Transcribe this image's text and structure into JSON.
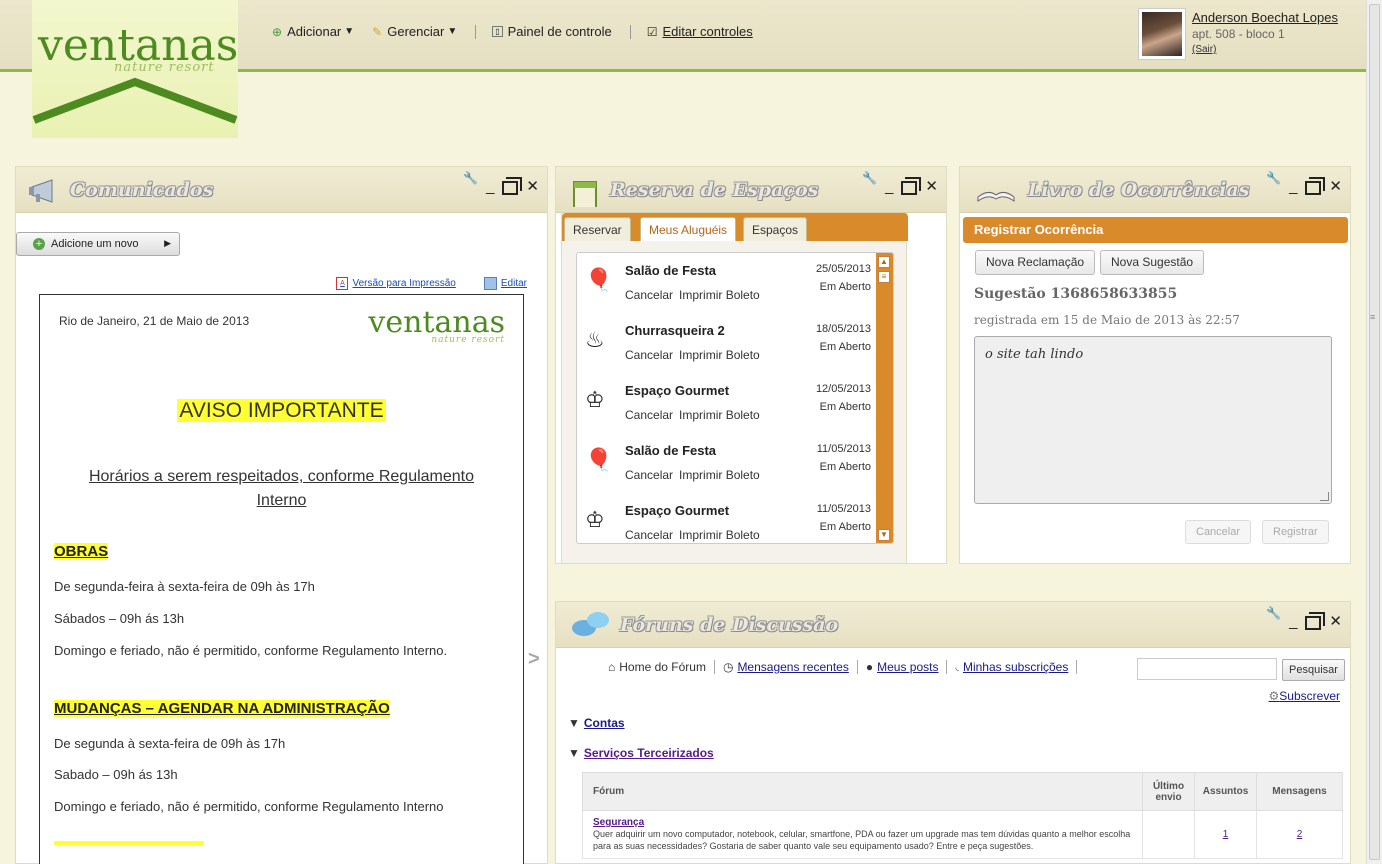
{
  "brand": {
    "name": "ventanas",
    "tagline": "nature resort",
    "green": "#4d8a1f"
  },
  "menu": {
    "add": "Adicionar",
    "manage": "Gerenciar",
    "panel": "Painel de controle",
    "edit_controls": "Editar controles"
  },
  "user": {
    "name": "Anderson Boechat Lopes",
    "apartment": "apt. 508 - bloco 1",
    "logout": "(Sair)"
  },
  "comunicados": {
    "title": "Comunicados",
    "add_button": "Adicione um novo",
    "print_link": "Versão para Impressão",
    "edit_link": "Editar",
    "doc": {
      "date": "Rio de Janeiro, 21 de Maio de 2013",
      "logo": "ventanas",
      "logo_sub": "nature resort",
      "heading": "AVISO IMPORTANTE",
      "subtitle": "Horários a serem respeitados, conforme Regulamento Interno",
      "sections": [
        {
          "title": "OBRAS",
          "lines": [
            "De segunda-feira à sexta-feira de 09h às 17h",
            "Sábados – 09h ás 13h",
            "Domingo e feriado, não é permitido, conforme Regulamento Interno."
          ]
        },
        {
          "title": "MUDANÇAS – AGENDAR NA ADMINISTRAÇÃO",
          "lines": [
            "De segunda à sexta-feira de 09h às 17h",
            "Sabado – 09h ás 13h",
            "Domingo e feriado, não é permitido, conforme Regulamento Interno"
          ]
        }
      ]
    }
  },
  "reserva": {
    "title": "Reserva de Espaços",
    "tabs": [
      "Reservar",
      "Meus Aluguéis",
      "Espaços"
    ],
    "active_tab": "Meus Aluguéis",
    "items": [
      {
        "name": "Salão de Festa",
        "date": "25/05/2013",
        "status": "Em Aberto",
        "icon": "balloons-icon",
        "cancel": "Cancelar",
        "print": "Imprimir Boleto"
      },
      {
        "name": "Churrasqueira 2",
        "date": "18/05/2013",
        "status": "Em Aberto",
        "icon": "grill-icon",
        "cancel": "Cancelar",
        "print": "Imprimir Boleto"
      },
      {
        "name": "Espaço Gourmet",
        "date": "12/05/2013",
        "status": "Em Aberto",
        "icon": "chef-hat-icon",
        "cancel": "Cancelar",
        "print": "Imprimir Boleto"
      },
      {
        "name": "Salão de Festa",
        "date": "11/05/2013",
        "status": "Em Aberto",
        "icon": "balloons-icon",
        "cancel": "Cancelar",
        "print": "Imprimir Boleto"
      },
      {
        "name": "Espaço Gourmet",
        "date": "11/05/2013",
        "status": "Em Aberto",
        "icon": "chef-hat-icon",
        "cancel": "Cancelar",
        "print": "Imprimir Boleto"
      }
    ],
    "accent": "#d98b2c"
  },
  "ocorrencias": {
    "title": "Livro de Ocorrências",
    "bar": "Registrar Ocorrência",
    "btn_complaint": "Nova Reclamação",
    "btn_suggestion": "Nova Sugestão",
    "entry_title": "Sugestão 1368658633855",
    "entry_meta": "registrada em 15 de Maio de 2013 às 22:57",
    "text": "o site tah lindo",
    "cancel": "Cancelar",
    "register": "Registrar"
  },
  "foruns": {
    "title": "Fóruns de Discussão",
    "nav": {
      "home": "Home do Fórum",
      "recent": "Mensagens recentes",
      "posts": "Meus posts",
      "subs": "Minhas subscrições"
    },
    "search_button": "Pesquisar",
    "subscribe": "Subscrever",
    "categories": [
      "Contas",
      "Serviços Terceirizados"
    ],
    "columns": [
      "Fórum",
      "Último envio",
      "Assuntos",
      "Mensagens"
    ],
    "rows": [
      {
        "name": "Segurança",
        "description": "Quer adquirir um novo computador, notebook, celular, smartfone, PDA ou fazer um upgrade mas tem dúvidas quanto a melhor escolha para as suas necessidades? Gostaria de saber quanto vale seu equipamento usado? Entre e peça sugestões.",
        "last": "",
        "topics": "1",
        "messages": "2"
      }
    ]
  }
}
